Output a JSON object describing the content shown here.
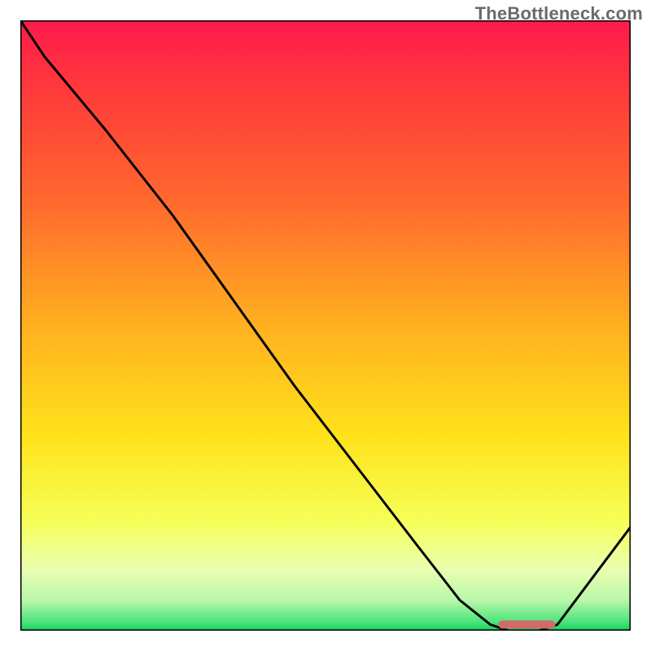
{
  "watermark": "TheBottleneck.com",
  "chart_data": {
    "type": "line",
    "title": "",
    "xlabel": "",
    "ylabel": "",
    "xlim": [
      0,
      100
    ],
    "ylim": [
      0,
      100
    ],
    "grid": false,
    "legend": false,
    "series": [
      {
        "name": "curve",
        "x": [
          0,
          4,
          14,
          25,
          35,
          45,
          55,
          65,
          72,
          77,
          80,
          85,
          88,
          100
        ],
        "y": [
          100,
          94,
          82,
          68,
          54,
          40,
          27,
          14,
          5,
          1,
          0,
          0,
          1,
          17
        ],
        "stroke": "#000000",
        "stroke_width": 3
      }
    ],
    "marker": {
      "name": "minimum-marker",
      "x": [
        79,
        87
      ],
      "y": [
        1,
        1
      ],
      "stroke": "#d36a6a",
      "stroke_width": 10
    },
    "gradient_stops": [
      {
        "offset": 0.0,
        "color": "#ff1a4b"
      },
      {
        "offset": 0.12,
        "color": "#ff3b3b"
      },
      {
        "offset": 0.3,
        "color": "#ff6a2d"
      },
      {
        "offset": 0.5,
        "color": "#ffb020"
      },
      {
        "offset": 0.68,
        "color": "#ffe21a"
      },
      {
        "offset": 0.82,
        "color": "#f6ff57"
      },
      {
        "offset": 0.9,
        "color": "#eaffb0"
      },
      {
        "offset": 0.95,
        "color": "#b9f7a9"
      },
      {
        "offset": 0.985,
        "color": "#4fe57e"
      },
      {
        "offset": 1.0,
        "color": "#18cf5a"
      }
    ]
  }
}
